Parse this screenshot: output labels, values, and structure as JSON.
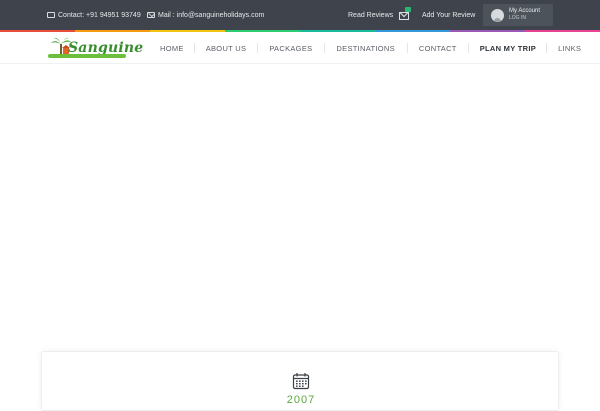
{
  "topbar": {
    "contact": "Contact: +91 94951 93749",
    "mail": "Mail : info@sanguineholidays.com",
    "read_reviews": "Read Reviews",
    "add_review": "Add Your Review",
    "account_title": "My Account",
    "account_sub": "LOG IN"
  },
  "logo": {
    "text": "Sanguine"
  },
  "nav": {
    "items": [
      {
        "label": "HOME"
      },
      {
        "label": "ABOUT US"
      },
      {
        "label": "PACKAGES"
      },
      {
        "label": "DESTINATIONS"
      },
      {
        "label": "CONTACT"
      },
      {
        "label": "PLAN MY TRIP"
      },
      {
        "label": "LINKS"
      }
    ]
  },
  "card": {
    "year": "2007"
  },
  "colors": {
    "topbar_bg": "#3f444c",
    "strip": [
      "#e74c3c",
      "#f39c12",
      "#f1c40f",
      "#2ecc71",
      "#1abc9c",
      "#3498db",
      "#9b59b6",
      "#e84393"
    ],
    "logo_green": "#3a8d2e",
    "accent_green": "#5aa83e",
    "badge_green": "#2bb673"
  }
}
